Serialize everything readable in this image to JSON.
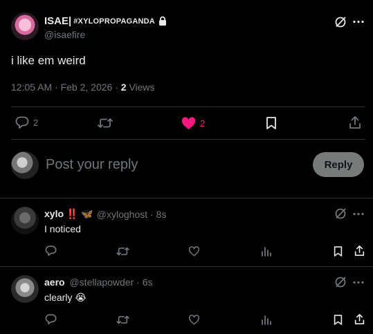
{
  "post": {
    "display_name": "ISAE|",
    "display_tag": "#xylopropaganda",
    "handle": "@isaefire",
    "text": "i like em weird",
    "timestamp": "12:05 AM · Feb 2, 2026 · ",
    "views_count": "2",
    "views_label": " Views",
    "actions": {
      "replies": "2",
      "likes": "2"
    }
  },
  "composer": {
    "placeholder": "Post your reply",
    "button_label": "Reply"
  },
  "replies": [
    {
      "display_name": "xylo ‼️",
      "handle_meta": "@xyloghost · 8s",
      "text": "I noticed",
      "butterfly": "🦋"
    },
    {
      "display_name": "aero",
      "handle_meta": "@stellapowder · 6s",
      "text": "clearly ",
      "emoji": "😭"
    }
  ],
  "colors": {
    "like": "#f91880",
    "muted": "#71767b",
    "divider": "#2f3336",
    "reply_button_bg": "#787a7a"
  }
}
